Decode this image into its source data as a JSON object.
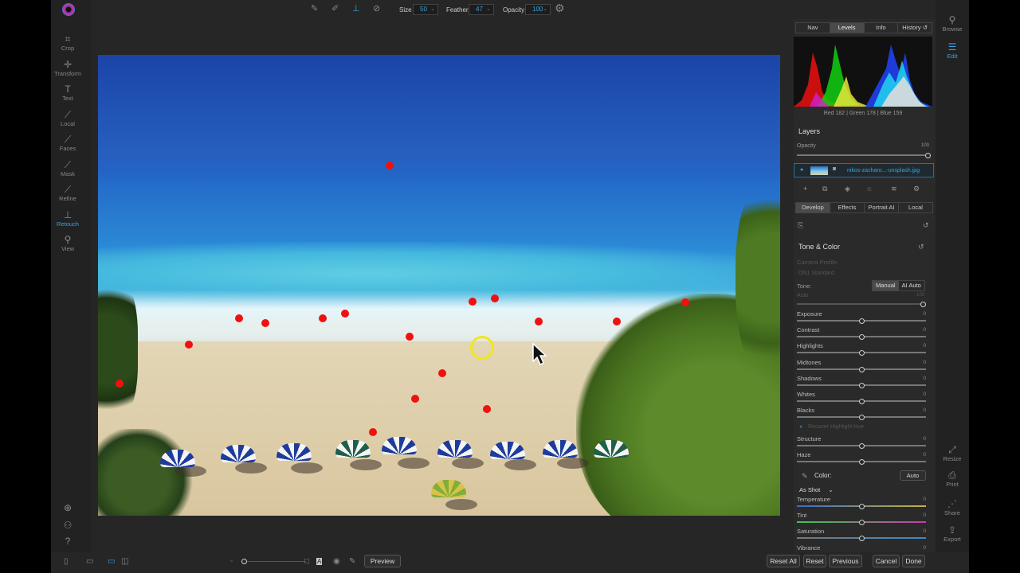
{
  "left_tools": [
    {
      "label": "Crop",
      "icon": "crop-icon",
      "glyph": "⌗"
    },
    {
      "label": "Transform",
      "icon": "move-icon",
      "glyph": "✛"
    },
    {
      "label": "Text",
      "icon": "text-icon",
      "glyph": "T"
    },
    {
      "label": "Local",
      "icon": "brush-icon",
      "glyph": "⟋"
    },
    {
      "label": "Faces",
      "icon": "faces-icon",
      "glyph": "⟋"
    },
    {
      "label": "Mask",
      "icon": "mask-brush-icon",
      "glyph": "⟋"
    },
    {
      "label": "Refine",
      "icon": "refine-brush-icon",
      "glyph": "⟋"
    },
    {
      "label": "Retouch",
      "icon": "retouch-stamp-icon",
      "glyph": "⊥",
      "active": true
    },
    {
      "label": "View",
      "icon": "zoom-icon",
      "glyph": "⚲"
    }
  ],
  "right_tools": [
    {
      "label": "Browse",
      "icon": "browse-icon"
    },
    {
      "label": "Edit",
      "icon": "sliders-icon",
      "active": true
    },
    {
      "label": "Resize",
      "icon": "resize-icon"
    },
    {
      "label": "Print",
      "icon": "print-icon"
    },
    {
      "label": "Share",
      "icon": "share-icon"
    },
    {
      "label": "Export",
      "icon": "export-icon"
    }
  ],
  "toolbar": {
    "size_label": "Size",
    "size_value": "50",
    "feather_label": "Feather",
    "feather_value": "47",
    "opacity_label": "Opacity",
    "opacity_value": "100"
  },
  "panel": {
    "tabs": [
      "Nav",
      "Levels",
      "Info",
      "History"
    ],
    "active_tab": "Levels",
    "rgb_readout": "Red 182 | Green 178 | Blue 159",
    "layers_title": "Layers",
    "opacity_label": "Opacity",
    "opacity_value": "100",
    "layer_name": "nikos-zacharo...-unsplash.jpg",
    "bottom_tabs": [
      "Develop",
      "Effects",
      "Portrait AI",
      "Local"
    ],
    "section_title": "Tone & Color",
    "camera_profile_label": "Camera Profile:",
    "camera_profile_value": "ON1 Standard",
    "tone_label": "Tone:",
    "tone_manual": "Manual",
    "tone_ai": "AI Auto",
    "auto_label": "Auto",
    "auto_value": "100",
    "sliders": [
      {
        "label": "Exposure",
        "value": "0",
        "pos": 0.5
      },
      {
        "label": "Contrast",
        "value": "0",
        "pos": 0.5
      },
      {
        "label": "Highlights",
        "value": "0",
        "pos": 0.5
      },
      {
        "label": "Midtones",
        "value": "0",
        "pos": 0.5
      },
      {
        "label": "Shadows",
        "value": "0",
        "pos": 0.5
      },
      {
        "label": "Whites",
        "value": "0",
        "pos": 0.5
      },
      {
        "label": "Blacks",
        "value": "0",
        "pos": 0.5
      }
    ],
    "recover_label": "Recover Highlight Hue",
    "sliders2": [
      {
        "label": "Structure",
        "value": "0"
      },
      {
        "label": "Haze",
        "value": "0"
      }
    ],
    "color_label": "Color:",
    "color_auto": "Auto",
    "white_balance": "As Shot",
    "sliders3": [
      {
        "label": "Temperature",
        "value": "0"
      },
      {
        "label": "Tint",
        "value": "0"
      },
      {
        "label": "Saturation",
        "value": "0"
      },
      {
        "label": "Vibrance",
        "value": "0"
      }
    ]
  },
  "bottom": {
    "preview": "Preview",
    "reset_all": "Reset All",
    "reset": "Reset",
    "previous": "Previous",
    "cancel": "Cancel",
    "done": "Done"
  },
  "colors": {
    "accent": "#3aa0e0",
    "retouch_dot": "#f01010",
    "brush_ring": "#f2e61a"
  }
}
